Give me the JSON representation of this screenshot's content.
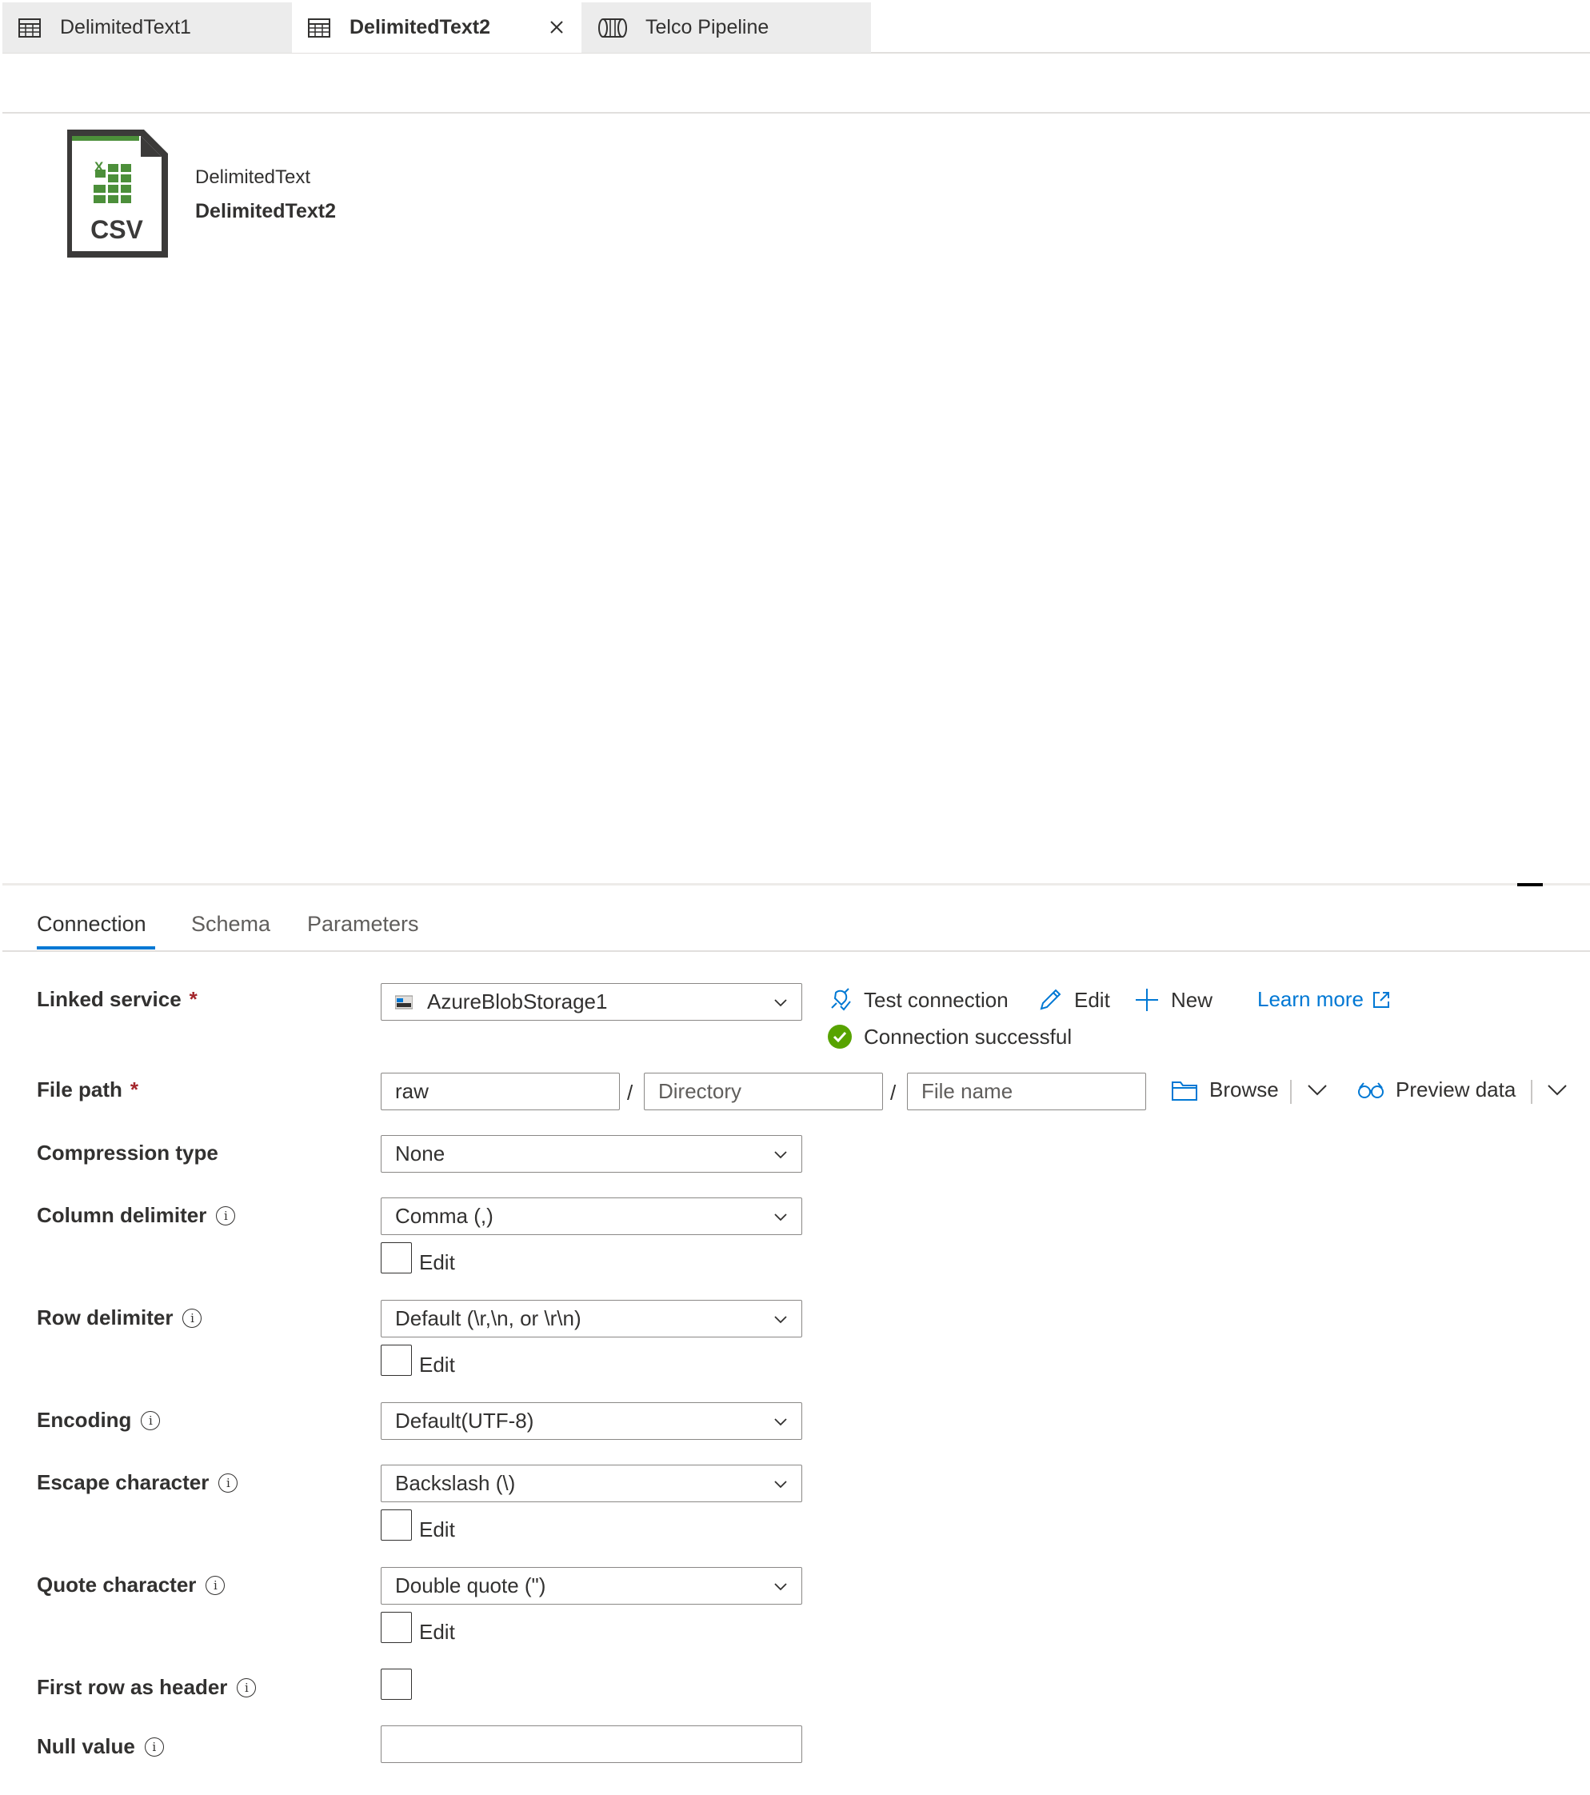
{
  "tabs": [
    {
      "label": "DelimitedText1",
      "icon": "table-icon",
      "active": false
    },
    {
      "label": "DelimitedText2",
      "icon": "table-icon",
      "active": true,
      "closable": true
    },
    {
      "label": "Telco Pipeline",
      "icon": "pipeline-icon",
      "active": false
    }
  ],
  "dataset": {
    "icon_text": "CSV",
    "icon_letter": "X",
    "type": "DelimitedText",
    "name": "DelimitedText2"
  },
  "panel_tabs": [
    {
      "label": "Connection",
      "active": true
    },
    {
      "label": "Schema",
      "active": false
    },
    {
      "label": "Parameters",
      "active": false
    }
  ],
  "form": {
    "linked_service": {
      "label": "Linked service",
      "required": "*",
      "value": "AzureBlobStorage1",
      "actions": {
        "test_connection": "Test connection",
        "edit": "Edit",
        "new": "New",
        "learn_more": "Learn more"
      },
      "status": "Connection successful"
    },
    "file_path": {
      "label": "File path",
      "required": "*",
      "container": "raw",
      "directory_placeholder": "Directory",
      "filename_placeholder": "File name",
      "separator": "/",
      "browse": "Browse",
      "preview": "Preview data"
    },
    "compression_type": {
      "label": "Compression type",
      "value": "None"
    },
    "column_delimiter": {
      "label": "Column delimiter",
      "value": "Comma (,)",
      "edit_label": "Edit"
    },
    "row_delimiter": {
      "label": "Row delimiter",
      "value": "Default (\\r,\\n, or \\r\\n)",
      "edit_label": "Edit"
    },
    "encoding": {
      "label": "Encoding",
      "value": "Default(UTF-8)"
    },
    "escape_character": {
      "label": "Escape character",
      "value": "Backslash (\\)",
      "edit_label": "Edit"
    },
    "quote_character": {
      "label": "Quote character",
      "value": "Double quote (\")",
      "edit_label": "Edit"
    },
    "first_row_header": {
      "label": "First row as header",
      "checked": false
    },
    "null_value": {
      "label": "Null value",
      "value": ""
    }
  },
  "colors": {
    "accent": "#0078d4",
    "success": "#57a300",
    "required": "#a4262c",
    "excel_green": "#4c8f3a",
    "icon_dark": "#3b3a39"
  }
}
